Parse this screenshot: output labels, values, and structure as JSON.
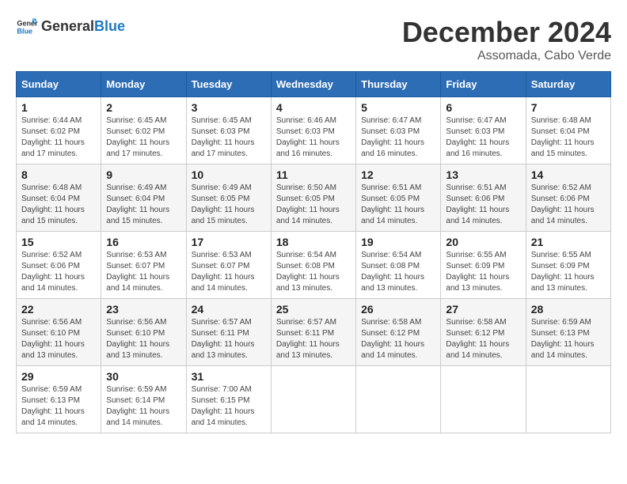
{
  "header": {
    "logo_general": "General",
    "logo_blue": "Blue",
    "month_title": "December 2024",
    "subtitle": "Assomada, Cabo Verde"
  },
  "days_of_week": [
    "Sunday",
    "Monday",
    "Tuesday",
    "Wednesday",
    "Thursday",
    "Friday",
    "Saturday"
  ],
  "weeks": [
    [
      {
        "day": "1",
        "sunrise": "6:44 AM",
        "sunset": "6:02 PM",
        "daylight": "11 hours and 17 minutes."
      },
      {
        "day": "2",
        "sunrise": "6:45 AM",
        "sunset": "6:02 PM",
        "daylight": "11 hours and 17 minutes."
      },
      {
        "day": "3",
        "sunrise": "6:45 AM",
        "sunset": "6:03 PM",
        "daylight": "11 hours and 17 minutes."
      },
      {
        "day": "4",
        "sunrise": "6:46 AM",
        "sunset": "6:03 PM",
        "daylight": "11 hours and 16 minutes."
      },
      {
        "day": "5",
        "sunrise": "6:47 AM",
        "sunset": "6:03 PM",
        "daylight": "11 hours and 16 minutes."
      },
      {
        "day": "6",
        "sunrise": "6:47 AM",
        "sunset": "6:03 PM",
        "daylight": "11 hours and 16 minutes."
      },
      {
        "day": "7",
        "sunrise": "6:48 AM",
        "sunset": "6:04 PM",
        "daylight": "11 hours and 15 minutes."
      }
    ],
    [
      {
        "day": "8",
        "sunrise": "6:48 AM",
        "sunset": "6:04 PM",
        "daylight": "11 hours and 15 minutes."
      },
      {
        "day": "9",
        "sunrise": "6:49 AM",
        "sunset": "6:04 PM",
        "daylight": "11 hours and 15 minutes."
      },
      {
        "day": "10",
        "sunrise": "6:49 AM",
        "sunset": "6:05 PM",
        "daylight": "11 hours and 15 minutes."
      },
      {
        "day": "11",
        "sunrise": "6:50 AM",
        "sunset": "6:05 PM",
        "daylight": "11 hours and 14 minutes."
      },
      {
        "day": "12",
        "sunrise": "6:51 AM",
        "sunset": "6:05 PM",
        "daylight": "11 hours and 14 minutes."
      },
      {
        "day": "13",
        "sunrise": "6:51 AM",
        "sunset": "6:06 PM",
        "daylight": "11 hours and 14 minutes."
      },
      {
        "day": "14",
        "sunrise": "6:52 AM",
        "sunset": "6:06 PM",
        "daylight": "11 hours and 14 minutes."
      }
    ],
    [
      {
        "day": "15",
        "sunrise": "6:52 AM",
        "sunset": "6:06 PM",
        "daylight": "11 hours and 14 minutes."
      },
      {
        "day": "16",
        "sunrise": "6:53 AM",
        "sunset": "6:07 PM",
        "daylight": "11 hours and 14 minutes."
      },
      {
        "day": "17",
        "sunrise": "6:53 AM",
        "sunset": "6:07 PM",
        "daylight": "11 hours and 14 minutes."
      },
      {
        "day": "18",
        "sunrise": "6:54 AM",
        "sunset": "6:08 PM",
        "daylight": "11 hours and 13 minutes."
      },
      {
        "day": "19",
        "sunrise": "6:54 AM",
        "sunset": "6:08 PM",
        "daylight": "11 hours and 13 minutes."
      },
      {
        "day": "20",
        "sunrise": "6:55 AM",
        "sunset": "6:09 PM",
        "daylight": "11 hours and 13 minutes."
      },
      {
        "day": "21",
        "sunrise": "6:55 AM",
        "sunset": "6:09 PM",
        "daylight": "11 hours and 13 minutes."
      }
    ],
    [
      {
        "day": "22",
        "sunrise": "6:56 AM",
        "sunset": "6:10 PM",
        "daylight": "11 hours and 13 minutes."
      },
      {
        "day": "23",
        "sunrise": "6:56 AM",
        "sunset": "6:10 PM",
        "daylight": "11 hours and 13 minutes."
      },
      {
        "day": "24",
        "sunrise": "6:57 AM",
        "sunset": "6:11 PM",
        "daylight": "11 hours and 13 minutes."
      },
      {
        "day": "25",
        "sunrise": "6:57 AM",
        "sunset": "6:11 PM",
        "daylight": "11 hours and 13 minutes."
      },
      {
        "day": "26",
        "sunrise": "6:58 AM",
        "sunset": "6:12 PM",
        "daylight": "11 hours and 14 minutes."
      },
      {
        "day": "27",
        "sunrise": "6:58 AM",
        "sunset": "6:12 PM",
        "daylight": "11 hours and 14 minutes."
      },
      {
        "day": "28",
        "sunrise": "6:59 AM",
        "sunset": "6:13 PM",
        "daylight": "11 hours and 14 minutes."
      }
    ],
    [
      {
        "day": "29",
        "sunrise": "6:59 AM",
        "sunset": "6:13 PM",
        "daylight": "11 hours and 14 minutes."
      },
      {
        "day": "30",
        "sunrise": "6:59 AM",
        "sunset": "6:14 PM",
        "daylight": "11 hours and 14 minutes."
      },
      {
        "day": "31",
        "sunrise": "7:00 AM",
        "sunset": "6:15 PM",
        "daylight": "11 hours and 14 minutes."
      },
      null,
      null,
      null,
      null
    ]
  ],
  "labels": {
    "sunrise": "Sunrise: ",
    "sunset": "Sunset: ",
    "daylight": "Daylight: "
  }
}
